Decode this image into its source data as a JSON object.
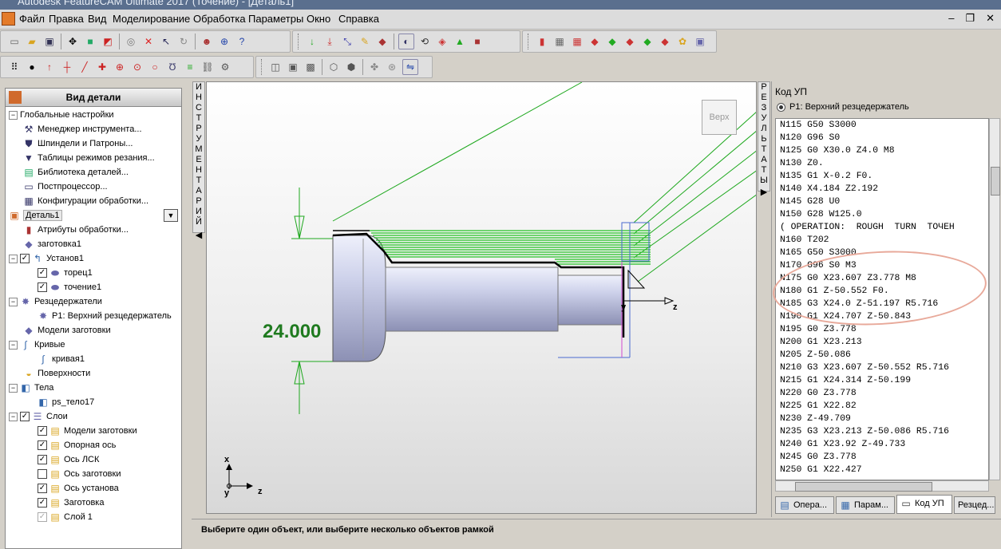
{
  "window": {
    "title": "Autodesk FeatureCAM Ultimate 2017 (Точение) - [Деталь1]"
  },
  "menu": [
    "Файл",
    "Правка",
    "Вид",
    "Моделирование",
    "Обработка",
    "Параметры",
    "Окно",
    "Справка"
  ],
  "tree": {
    "header": "Вид детали",
    "items": [
      {
        "label": "Глобальные настройки",
        "icon": "globe-icon"
      },
      {
        "label": "Менеджер инструмента...",
        "icon": "tool-manager-icon"
      },
      {
        "label": "Шпиндели и Патроны...",
        "icon": "spindle-icon"
      },
      {
        "label": "Таблицы режимов резания...",
        "icon": "feeds-table-icon"
      },
      {
        "label": "Библиотека деталей...",
        "icon": "library-icon"
      },
      {
        "label": "Постпроцессор...",
        "icon": "post-icon"
      },
      {
        "label": "Конфигурации обработки...",
        "icon": "config-icon"
      },
      {
        "label": "Деталь1",
        "icon": "part-icon"
      },
      {
        "label": "Атрибуты обработки...",
        "icon": "attributes-icon"
      },
      {
        "label": "заготовка1",
        "icon": "stock-icon"
      },
      {
        "label": "Установ1",
        "icon": "setup-icon"
      },
      {
        "label": "торец1",
        "icon": "face-feature-icon"
      },
      {
        "label": "точение1",
        "icon": "turn-feature-icon"
      },
      {
        "label": "Резцедержатели",
        "icon": "turret-icon"
      },
      {
        "label": "P1: Верхний резцедержатель",
        "icon": "turret-icon"
      },
      {
        "label": "Модели заготовки",
        "icon": "stock-model-icon"
      },
      {
        "label": "Кривые",
        "icon": "curve-icon"
      },
      {
        "label": "кривая1",
        "icon": "curve-icon"
      },
      {
        "label": "Поверхности",
        "icon": "surface-icon"
      },
      {
        "label": "Тела",
        "icon": "solid-icon"
      },
      {
        "label": "ps_тело17",
        "icon": "solid-icon"
      },
      {
        "label": "Слои",
        "icon": "layers-icon"
      },
      {
        "label": "Модели заготовки",
        "icon": "layer-icon"
      },
      {
        "label": "Опорная ось",
        "icon": "layer-icon"
      },
      {
        "label": "Ось ЛСК",
        "icon": "layer-icon"
      },
      {
        "label": "Ось заготовки",
        "icon": "layer-icon"
      },
      {
        "label": "Ось установа",
        "icon": "layer-icon"
      },
      {
        "label": "Заготовка",
        "icon": "layer-icon"
      },
      {
        "label": "Слой 1",
        "icon": "layer-icon"
      }
    ]
  },
  "left_strip": "ИНСТРУМЕНТАРИЙ",
  "right_strip": "РЕЗУЛЬТАТЫ",
  "viewport": {
    "view_cube": "Верх",
    "dimension": "24.000",
    "axis_labels": {
      "x": "x",
      "y": "y",
      "z": "z"
    },
    "colors": {
      "toolpath": "#22c022",
      "guide": "#1ea81e",
      "part": "#c9cde8"
    }
  },
  "nc": {
    "title": "Код УП",
    "tool": "P1: Верхний резцедержатель",
    "lines": [
      "N115 G50 S3000",
      "N120 G96 S0",
      "N125 G0 X30.0 Z4.0 M8",
      "N130 Z0.",
      "N135 G1 X-0.2 F0.",
      "N140 X4.184 Z2.192",
      "N145 G28 U0",
      "N150 G28 W125.0",
      "( OPERATION:  ROUGH  TURN  ТОЧЕН",
      "N160 T202",
      "N165 G50 S3000",
      "N170 G96 S0 M3",
      "N175 G0 X23.607 Z3.778 M8",
      "N180 G1 Z-50.552 F0.",
      "N185 G3 X24.0 Z-51.197 R5.716",
      "N190 G1 X24.707 Z-50.843",
      "N195 G0 Z3.778",
      "N200 G1 X23.213",
      "N205 Z-50.086",
      "N210 G3 X23.607 Z-50.552 R5.716",
      "N215 G1 X24.314 Z-50.199",
      "N220 G0 Z3.778",
      "N225 G1 X22.82",
      "N230 Z-49.709",
      "N235 G3 X23.213 Z-50.086 R5.716",
      "N240 G1 X23.92 Z-49.733",
      "N245 G0 Z3.778",
      "N250 G1 X22.427"
    ],
    "tabs": [
      "Опера...",
      "Парам...",
      "Код УП",
      "Резцед..."
    ]
  },
  "status": "Выберите один объект, или выберите несколько объектов рамкой"
}
